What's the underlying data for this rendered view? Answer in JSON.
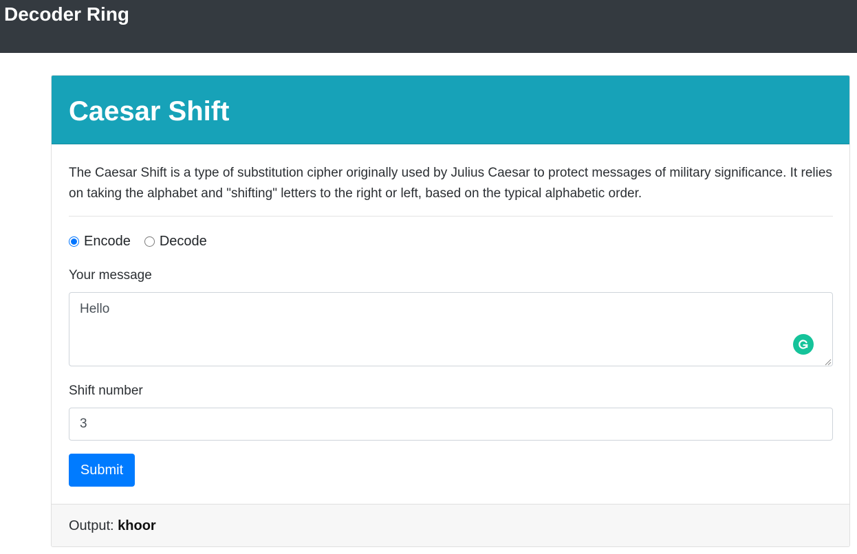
{
  "navbar": {
    "brand": "Decoder Ring",
    "background": "#343a40"
  },
  "card": {
    "title": "Caesar Shift",
    "header_color": "#17a2b8",
    "description": "The Caesar Shift is a type of substitution cipher originally used by Julius Caesar to protect messages of military significance. It relies on taking the alphabet and \"shifting\" letters to the right or left, based on the typical alphabetic order."
  },
  "form": {
    "modes": [
      {
        "label": "Encode",
        "checked": true
      },
      {
        "label": "Decode",
        "checked": false
      }
    ],
    "message_label": "Your message",
    "message_value": "Hello",
    "shift_label": "Shift number",
    "shift_value": "3",
    "submit_label": "Submit",
    "submit_color": "#007bff"
  },
  "output": {
    "label": "Output:",
    "value": "khoor"
  },
  "icons": {
    "grammarly": "grammarly-icon",
    "resize": "resize-handle-icon"
  }
}
